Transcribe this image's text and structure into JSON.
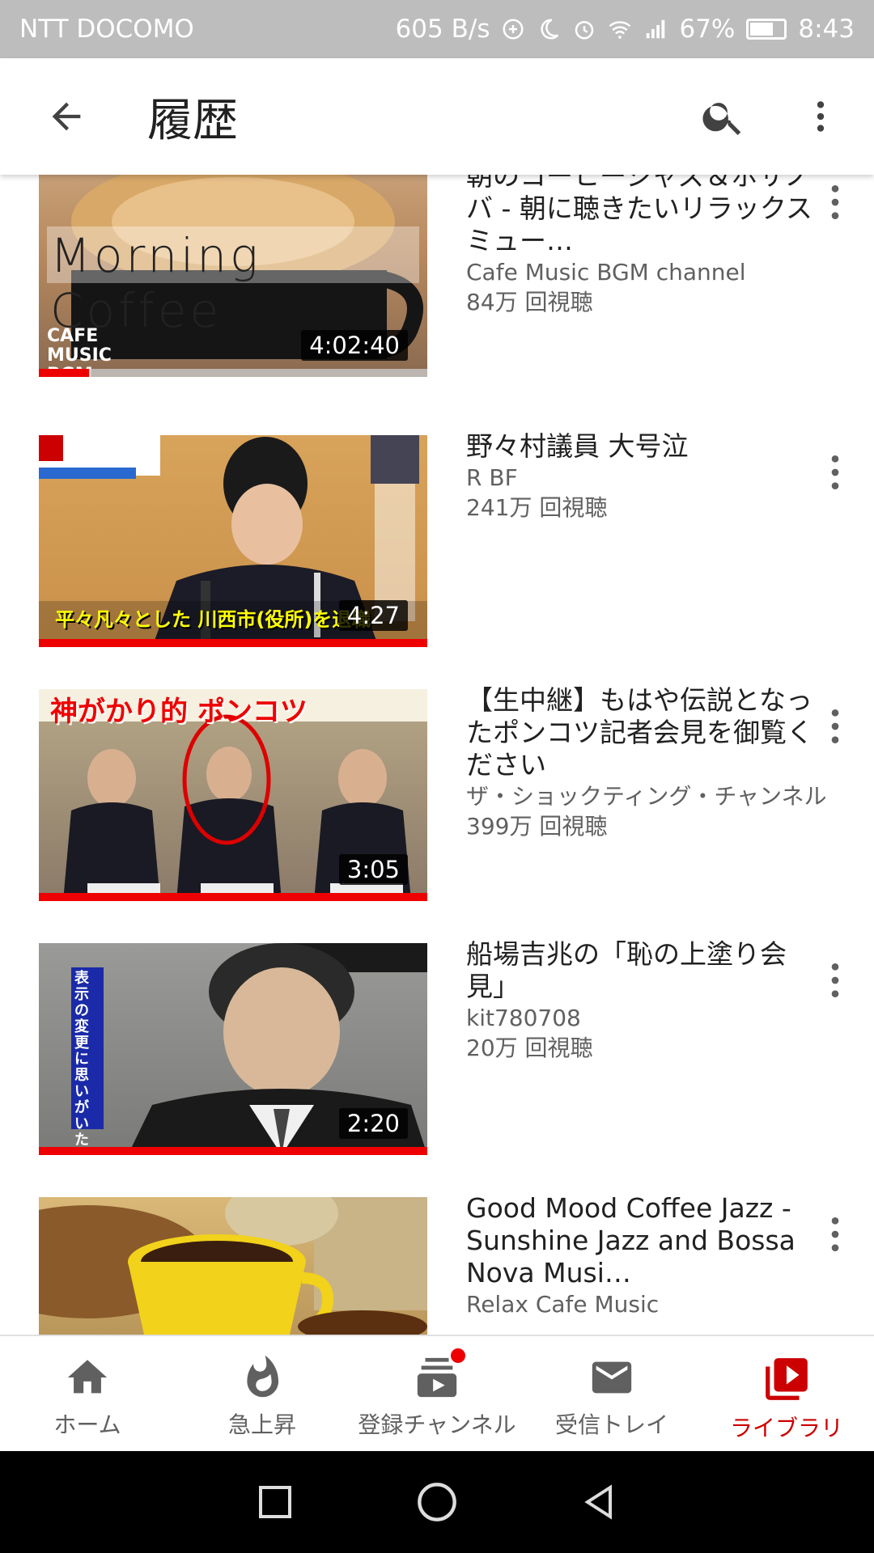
{
  "status_bar": {
    "carrier": "NTT DOCOMO",
    "speed": "605 B/s",
    "battery": "67%",
    "time": "8:43"
  },
  "app_bar": {
    "title": "履歴"
  },
  "videos": [
    {
      "title": "朝のコーヒージャズ＆ボサノバ - 朝に聴きたいリラックスミュー…",
      "channel": "Cafe Music BGM channel",
      "views": "84万 回視聴",
      "duration": "4:02:40",
      "watched_fraction": 0.13,
      "thumb_overlay_text": "Morning Coffee",
      "thumb_brand_text": "CAFE MUSIC BGM Chann"
    },
    {
      "title": "野々村議員 大号泣",
      "channel": "R BF",
      "views": "241万 回視聴",
      "duration": "4:27",
      "watched_fraction": 1.0,
      "thumb_caption": "平々凡々とした 川西市(役所)を退職"
    },
    {
      "title": "【生中継】もはや伝説となったポンコツ記者会見を御覧ください",
      "channel": "ザ・ショックティング・チャンネル",
      "views": "399万 回視聴",
      "duration": "3:05",
      "watched_fraction": 1.0,
      "thumb_caption": "神がかり的 ポンコツ"
    },
    {
      "title": "船場吉兆の「恥の上塗り会見」",
      "channel": "kit780708",
      "views": "20万 回視聴",
      "duration": "2:20",
      "watched_fraction": 1.0,
      "thumb_caption": "表示の変更に思いがいたらなかったのは?"
    },
    {
      "title": "Good Mood Coffee Jazz - Sunshine Jazz and Bossa Nova Musi…",
      "channel": "Relax Cafe Music",
      "views": "",
      "duration": "",
      "watched_fraction": 0
    }
  ],
  "bottom_nav": [
    {
      "label": "ホーム",
      "icon": "home-icon",
      "active": false
    },
    {
      "label": "急上昇",
      "icon": "trending-icon",
      "active": false
    },
    {
      "label": "登録チャンネル",
      "icon": "subscriptions-icon",
      "active": false,
      "badge": true
    },
    {
      "label": "受信トレイ",
      "icon": "inbox-icon",
      "active": false
    },
    {
      "label": "ライブラリ",
      "icon": "library-icon",
      "active": true
    }
  ],
  "colors": {
    "accent": "#cc0000",
    "status_bar": "#bdbdbd",
    "secondary_text": "#606060"
  }
}
